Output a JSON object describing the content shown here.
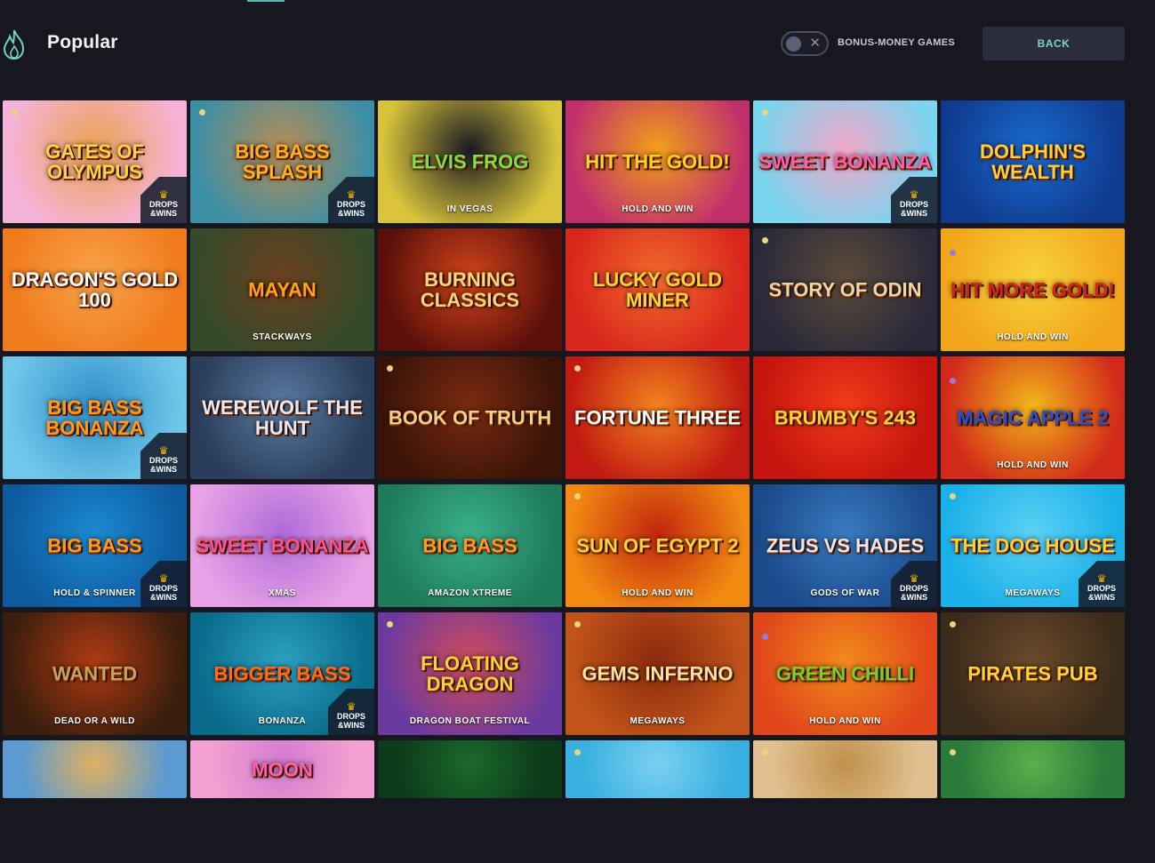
{
  "header": {
    "title": "Popular",
    "toggle_label": "BONUS-MONEY GAMES",
    "back_label": "BACK"
  },
  "badge": {
    "line1": "DROPS",
    "line2": "&WINS"
  },
  "icons": {
    "section": "flame-icon",
    "toggle_off": "close-icon",
    "badge": "crown-icon"
  },
  "games": [
    {
      "name": "Gates of Olympus",
      "sub": "",
      "badge": true,
      "dot": "yellow",
      "colors": [
        "#f6b3d9",
        "#e9a14e"
      ],
      "text": "#ffd24a"
    },
    {
      "name": "Big Bass Splash",
      "sub": "",
      "badge": true,
      "dot": "yellow",
      "colors": [
        "#3d8fa6",
        "#b98b52"
      ],
      "text": "#ffb11f"
    },
    {
      "name": "Elvis Frog",
      "sub": "IN VEGAS",
      "badge": false,
      "dot": "none",
      "colors": [
        "#d8c33a",
        "#1a1a22"
      ],
      "text": "#7be04a"
    },
    {
      "name": "Hit The Gold!",
      "sub": "HOLD AND WIN",
      "badge": false,
      "dot": "none",
      "colors": [
        "#c2306b",
        "#f0a018"
      ],
      "text": "#ffcf22"
    },
    {
      "name": "Sweet Bonanza",
      "sub": "",
      "badge": true,
      "dot": "yellow",
      "colors": [
        "#79d5f0",
        "#f2a7c7"
      ],
      "text": "#ff5fae"
    },
    {
      "name": "Dolphin's Wealth",
      "sub": "",
      "badge": false,
      "dot": "none",
      "colors": [
        "#0f3b8e",
        "#1a6bd0"
      ],
      "text": "#ffcf3a"
    },
    {
      "name": "Dragon's Gold 100",
      "sub": "",
      "badge": false,
      "dot": "none",
      "colors": [
        "#f07a1c",
        "#f8a34a"
      ],
      "text": "#ffffff"
    },
    {
      "name": "Mayan",
      "sub": "STACKWAYS",
      "badge": false,
      "dot": "none",
      "colors": [
        "#344a2a",
        "#6b3f1e"
      ],
      "text": "#ffa21a"
    },
    {
      "name": "Burning Classics",
      "sub": "",
      "badge": false,
      "dot": "none",
      "colors": [
        "#5a0f0a",
        "#d2431a"
      ],
      "text": "#ffd57a"
    },
    {
      "name": "Lucky Gold Miner",
      "sub": "",
      "badge": false,
      "dot": "none",
      "colors": [
        "#d9261d",
        "#f06a2a"
      ],
      "text": "#ffd23a"
    },
    {
      "name": "Story of Odin",
      "sub": "",
      "badge": false,
      "dot": "yellow",
      "colors": [
        "#2c2a3a",
        "#5a4a3a"
      ],
      "text": "#e8d7a8"
    },
    {
      "name": "Hit More Gold!",
      "sub": "HOLD AND WIN",
      "badge": false,
      "dot": "purple",
      "colors": [
        "#f2a51a",
        "#f7d23a"
      ],
      "text": "#d4241b"
    },
    {
      "name": "Big Bass Bonanza",
      "sub": "",
      "badge": true,
      "dot": "none",
      "colors": [
        "#6fc7ea",
        "#2f8fc8"
      ],
      "text": "#ff9a1f"
    },
    {
      "name": "Werewolf The Hunt",
      "sub": "",
      "badge": false,
      "dot": "none",
      "colors": [
        "#2a3d5a",
        "#5a7aa0"
      ],
      "text": "#e8e8f0"
    },
    {
      "name": "Book of Truth",
      "sub": "",
      "badge": false,
      "dot": "yellow",
      "colors": [
        "#3a1408",
        "#7a2a10"
      ],
      "text": "#f3d08a"
    },
    {
      "name": "Fortune Three",
      "sub": "",
      "badge": false,
      "dot": "yellow",
      "colors": [
        "#c21a12",
        "#f2821e"
      ],
      "text": "#ffffff"
    },
    {
      "name": "Brumby's 243",
      "sub": "",
      "badge": false,
      "dot": "none",
      "colors": [
        "#c4140d",
        "#f23a1a"
      ],
      "text": "#ffd23a"
    },
    {
      "name": "Magic Apple 2",
      "sub": "HOLD AND WIN",
      "badge": false,
      "dot": "purple",
      "colors": [
        "#d22a1a",
        "#f2b61a"
      ],
      "text": "#2a4fd0"
    },
    {
      "name": "Big Bass",
      "sub": "HOLD & SPINNER",
      "badge": true,
      "dot": "none",
      "colors": [
        "#0e5aa0",
        "#1a8ad0"
      ],
      "text": "#ff9a1f"
    },
    {
      "name": "Sweet Bonanza",
      "sub": "XMAS",
      "badge": false,
      "dot": "none",
      "colors": [
        "#e8a2e6",
        "#b06ad8"
      ],
      "text": "#ff4f9a"
    },
    {
      "name": "Big Bass",
      "sub": "AMAZON XTREME",
      "badge": false,
      "dot": "none",
      "colors": [
        "#1d7a5a",
        "#3ab08a"
      ],
      "text": "#ff9a1f"
    },
    {
      "name": "Sun of Egypt 2",
      "sub": "HOLD AND WIN",
      "badge": false,
      "dot": "yellow",
      "colors": [
        "#f28a12",
        "#c2260d"
      ],
      "text": "#ffd23a"
    },
    {
      "name": "Zeus vs Hades",
      "sub": "GODS OF WAR",
      "badge": true,
      "dot": "none",
      "colors": [
        "#1a4a8a",
        "#3a7ac0"
      ],
      "text": "#e8e8f0"
    },
    {
      "name": "The Dog House",
      "sub": "MEGAWAYS",
      "badge": true,
      "dot": "yellow",
      "colors": [
        "#1ab0e8",
        "#5ad0f5"
      ],
      "text": "#ffcf3a"
    },
    {
      "name": "Wanted",
      "sub": "DEAD OR A WILD",
      "badge": false,
      "dot": "none",
      "colors": [
        "#3a1e0d",
        "#b03a12"
      ],
      "text": "#c8a25a"
    },
    {
      "name": "Bigger Bass",
      "sub": "BONANZA",
      "badge": true,
      "dot": "none",
      "colors": [
        "#0a6a8a",
        "#2aa0c0"
      ],
      "text": "#ff6a1f"
    },
    {
      "name": "Floating Dragon",
      "sub": "DRAGON BOAT FESTIVAL",
      "badge": false,
      "dot": "yellow",
      "colors": [
        "#6a3aa0",
        "#d04a5a"
      ],
      "text": "#ffcf3a"
    },
    {
      "name": "Gems Inferno",
      "sub": "MEGAWAYS",
      "badge": false,
      "dot": "yellow",
      "colors": [
        "#c2541a",
        "#8a2a0d"
      ],
      "text": "#ffe0a0"
    },
    {
      "name": "Green Chilli",
      "sub": "HOLD AND WIN",
      "badge": false,
      "dot": "purple",
      "colors": [
        "#e0461a",
        "#f28a1a"
      ],
      "text": "#7ad02a"
    },
    {
      "name": "Pirates Pub",
      "sub": "",
      "badge": false,
      "dot": "yellow",
      "colors": [
        "#3a2a1a",
        "#6a4a2a"
      ],
      "text": "#ffd23a"
    },
    {
      "name": "",
      "sub": "",
      "badge": false,
      "dot": "none",
      "colors": [
        "#5a9ad0",
        "#e0b060"
      ],
      "text": "#ffffff"
    },
    {
      "name": "Moon",
      "sub": "",
      "badge": false,
      "dot": "none",
      "colors": [
        "#f2a2d0",
        "#d07ad0"
      ],
      "text": "#ff5fae"
    },
    {
      "name": "",
      "sub": "",
      "badge": false,
      "dot": "none",
      "colors": [
        "#0d3a1a",
        "#1a6a2a"
      ],
      "text": "#ffd23a"
    },
    {
      "name": "",
      "sub": "",
      "badge": false,
      "dot": "yellow",
      "colors": [
        "#3ab0e0",
        "#7ad0f0"
      ],
      "text": "#ffd23a"
    },
    {
      "name": "",
      "sub": "",
      "badge": false,
      "dot": "yellow",
      "colors": [
        "#e0c090",
        "#c0904a"
      ],
      "text": "#ffd23a"
    },
    {
      "name": "",
      "sub": "",
      "badge": false,
      "dot": "yellow",
      "colors": [
        "#2a7a3a",
        "#5ab04a"
      ],
      "text": "#ffd23a"
    }
  ]
}
